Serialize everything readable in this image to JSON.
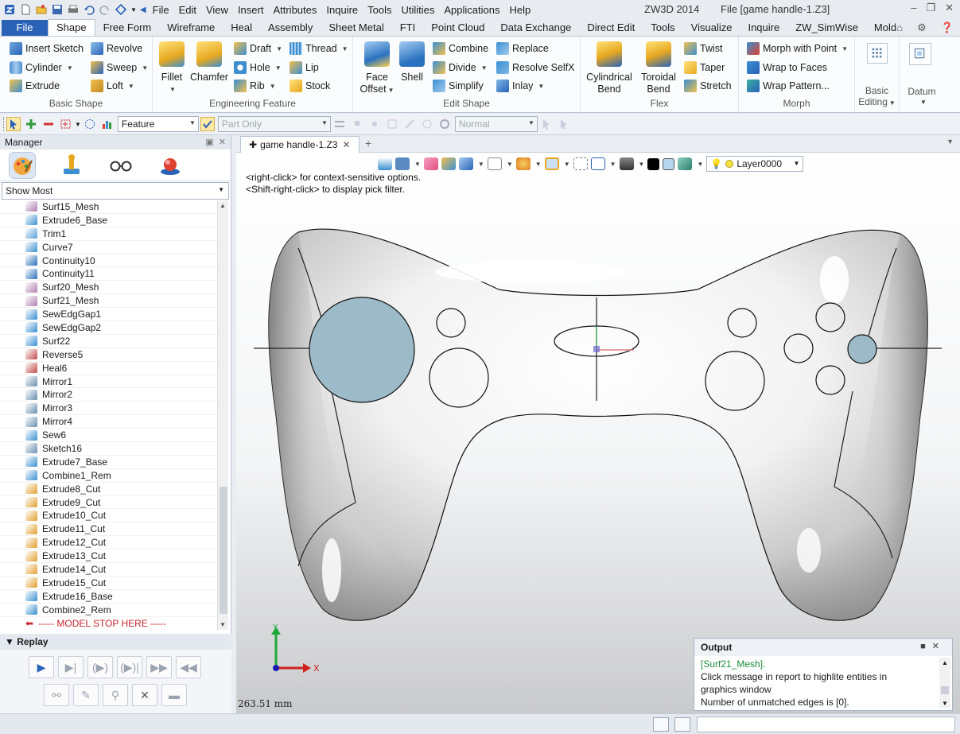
{
  "titlebar": {
    "app": "ZW3D 2014",
    "file": "File [game handle-1.Z3]",
    "menu": [
      "File",
      "Edit",
      "View",
      "Insert",
      "Attributes",
      "Inquire",
      "Tools",
      "Utilities",
      "Applications",
      "Help"
    ]
  },
  "tabs": [
    "File",
    "Shape",
    "Free Form",
    "Wireframe",
    "Heal",
    "Assembly",
    "Sheet Metal",
    "FTI",
    "Point Cloud",
    "Data Exchange",
    "Direct Edit",
    "Tools",
    "Visualize",
    "Inquire",
    "ZW_SimWise",
    "Mold"
  ],
  "active_tab": "Shape",
  "ribbon": {
    "basic_shape": {
      "label": "Basic Shape",
      "insert_sketch": "Insert Sketch",
      "revolve": "Revolve",
      "cylinder": "Cylinder",
      "sweep": "Sweep",
      "extrude": "Extrude",
      "loft": "Loft"
    },
    "engineering_feature": {
      "label": "Engineering Feature",
      "fillet": "Fillet",
      "chamfer": "Chamfer",
      "draft": "Draft",
      "thread": "Thread",
      "hole": "Hole",
      "lip": "Lip",
      "rib": "Rib",
      "stock": "Stock"
    },
    "edit_shape": {
      "label": "Edit Shape",
      "face_offset": "Face Offset",
      "shell": "Shell",
      "combine": "Combine",
      "replace": "Replace",
      "divide": "Divide",
      "resolve_selfx": "Resolve SelfX",
      "simplify": "Simplify",
      "inlay": "Inlay"
    },
    "flex": {
      "label": "Flex",
      "cylindrical_bend": "Cylindrical Bend",
      "toroidal_bend": "Toroidal Bend",
      "twist": "Twist",
      "taper": "Taper",
      "stretch": "Stretch"
    },
    "morph": {
      "label": "Morph",
      "morph_with_point": "Morph with Point",
      "wrap_to_faces": "Wrap to Faces",
      "wrap_pattern": "Wrap Pattern..."
    },
    "basic_editing": {
      "label": "Basic Editing"
    },
    "datum": {
      "label": "Datum"
    }
  },
  "toolbar2": {
    "filter": "Feature",
    "scope": "Part Only",
    "mode": "Normal"
  },
  "manager": {
    "title": "Manager",
    "show_filter": "Show Most",
    "history": [
      {
        "name": "Surf15_Mesh",
        "color": "#b07fb0"
      },
      {
        "name": "Extrude6_Base",
        "color": "#3b8fd0"
      },
      {
        "name": "Trim1",
        "color": "#5aa0d8"
      },
      {
        "name": "Curve7",
        "color": "#3b8fd0"
      },
      {
        "name": "Continuity10",
        "color": "#2a6fb8"
      },
      {
        "name": "Continuity11",
        "color": "#2a6fb8"
      },
      {
        "name": "Surf20_Mesh",
        "color": "#b07fb0"
      },
      {
        "name": "Surf21_Mesh",
        "color": "#b07fb0"
      },
      {
        "name": "SewEdgGap1",
        "color": "#3b8fd0"
      },
      {
        "name": "SewEdgGap2",
        "color": "#3b8fd0"
      },
      {
        "name": "Surf22",
        "color": "#3b8fd0"
      },
      {
        "name": "Reverse5",
        "color": "#c44a4a"
      },
      {
        "name": "Heal6",
        "color": "#c44a4a"
      },
      {
        "name": "Mirror1",
        "color": "#6a8fb0"
      },
      {
        "name": "Mirror2",
        "color": "#6a8fb0"
      },
      {
        "name": "Mirror3",
        "color": "#6a8fb0"
      },
      {
        "name": "Mirror4",
        "color": "#6a8fb0"
      },
      {
        "name": "Sew6",
        "color": "#3b8fd0"
      },
      {
        "name": "Sketch16",
        "color": "#6a8fb0"
      },
      {
        "name": "Extrude7_Base",
        "color": "#3b8fd0"
      },
      {
        "name": "Combine1_Rem",
        "color": "#3b8fd0"
      },
      {
        "name": "Extrude8_Cut",
        "color": "#e0a030"
      },
      {
        "name": "Extrude9_Cut",
        "color": "#e0a030"
      },
      {
        "name": "Extrude10_Cut",
        "color": "#e0a030"
      },
      {
        "name": "Extrude11_Cut",
        "color": "#e0a030"
      },
      {
        "name": "Extrude12_Cut",
        "color": "#e0a030"
      },
      {
        "name": "Extrude13_Cut",
        "color": "#e0a030"
      },
      {
        "name": "Extrude14_Cut",
        "color": "#e0a030"
      },
      {
        "name": "Extrude15_Cut",
        "color": "#e0a030"
      },
      {
        "name": "Extrude16_Base",
        "color": "#3b8fd0"
      },
      {
        "name": "Combine2_Rem",
        "color": "#3b8fd0"
      }
    ],
    "stop_marker": "----- MODEL STOP HERE -----"
  },
  "replay": {
    "title": "Replay"
  },
  "doc_tab": "game handle-1.Z3",
  "viewport": {
    "hint1": "<right-click> for context-sensitive options.",
    "hint2": "<Shift-right-click> to display pick filter.",
    "layer": "Layer0000",
    "dimension": "263.51 mm",
    "axis_x": "X",
    "axis_y": "Y"
  },
  "output": {
    "title": "Output",
    "lines": [
      "[Surf21_Mesh].",
      "Click message in report to highlite entities in",
      "graphics window",
      "Number of unmatched edges is [0]."
    ]
  }
}
